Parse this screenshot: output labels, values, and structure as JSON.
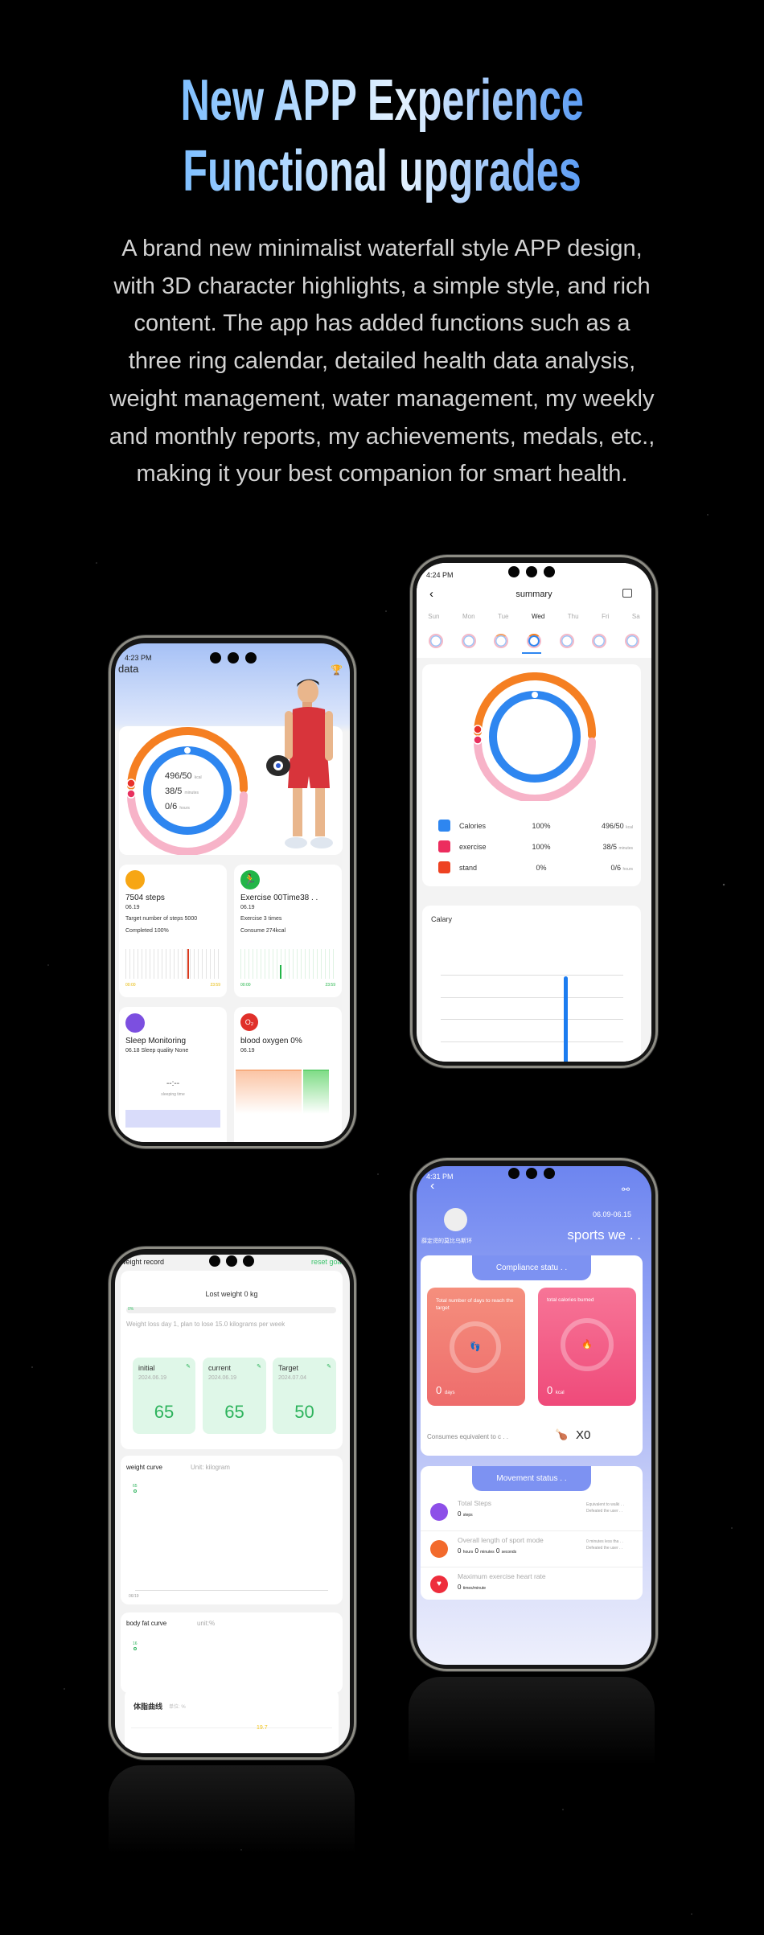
{
  "header": {
    "title_line1": "New APP Experience",
    "title_line2": "Functional upgrades",
    "description_lines": [
      "A brand new minimalist waterfall style APP design,",
      "with 3D character highlights, a simple style, and rich",
      "content. The app has added functions such as a",
      "three ring calendar, detailed health data analysis,",
      "weight management, water management, my weekly",
      "and monthly reports, my achievements, medals, etc.,",
      "making it your best companion for smart health."
    ]
  },
  "phone_data": {
    "status_time": "4:23 PM",
    "title": "data",
    "rings": {
      "calories": "496/50",
      "calories_unit": "kcal",
      "exercise": "38/5",
      "exercise_unit": "minutes",
      "stand": "0/6",
      "stand_unit": "hours"
    },
    "steps": {
      "title": "7504 steps",
      "date": "06.19",
      "target": "Target number of steps 5000",
      "completed": "Completed 100%",
      "start": "00:00",
      "end": "23:59"
    },
    "exercise": {
      "title": "Exercise 00Time38 . .",
      "date": "06.19",
      "times": "Exercise 3 times",
      "consume": "Consume 274kcal",
      "start": "00:00",
      "end": "23:59"
    },
    "sleep": {
      "title": "Sleep Monitoring",
      "subtitle": "06.18 Sleep quality None",
      "value": "--:--",
      "label": "sleeping time"
    },
    "oxygen": {
      "title": "blood oxygen 0%",
      "date": "06.19"
    }
  },
  "phone_summary": {
    "status_time": "4:24 PM",
    "title": "summary",
    "days": [
      "Sun",
      "Mon",
      "Tue",
      "Wed",
      "Thu",
      "Fri",
      "Sa"
    ],
    "selected_day": "Wed",
    "metrics": [
      {
        "label": "Calories",
        "percent": "100%",
        "value": "496/50",
        "unit": "kcal",
        "icon": "home-icon"
      },
      {
        "label": "exercise",
        "percent": "100%",
        "value": "38/5",
        "unit": "minutes",
        "icon": "stopwatch-icon"
      },
      {
        "label": "stand",
        "percent": "0%",
        "value": "0/6",
        "unit": "hours",
        "icon": "person-icon"
      }
    ],
    "chart_title": "Calary"
  },
  "phone_weight": {
    "title": "weight record",
    "reset": "reset goals",
    "lost": "Lost weight 0 kg",
    "progress_label": "0%",
    "progress_percent": 0,
    "plan": "Weight loss day 1, plan to lose 15.0 kilograms per week",
    "boxes": [
      {
        "label": "initial",
        "date": "2024.06.19",
        "value": "65"
      },
      {
        "label": "current",
        "date": "2024.06.19",
        "value": "65"
      },
      {
        "label": "Target",
        "date": "2024.07.04",
        "value": "50"
      }
    ],
    "weight_curve": {
      "title": "weight curve",
      "unit": "Unit: kilogram",
      "point": "65",
      "x_label": "06/19"
    },
    "body_fat": {
      "title": "body fat curve",
      "unit": "unit:%",
      "point": "16"
    },
    "cn_card": {
      "title": "体脂曲线",
      "unit": "单位: %",
      "point": "19.7"
    }
  },
  "phone_sports": {
    "status_time": "4:31 PM",
    "device": "薛定谔的莫比乌斯环",
    "date_range": "06.09-06.15",
    "title": "sports we . .",
    "compliance": "Compliance statu . .",
    "days_card": {
      "label": "Total number of days to reach the target",
      "value": "0",
      "unit": "days"
    },
    "kcal_card": {
      "label": "total calories burned",
      "value": "0",
      "unit": "kcal"
    },
    "equivalent": "Consumes equivalent to c . .",
    "equivalent_count": "X0",
    "movement": "Movement status . .",
    "rows": [
      {
        "title": "Total Steps",
        "v1": "0",
        "u1": "steps",
        "r1": "Equivalent to walki . .",
        "r2": "Defeated the user . ."
      },
      {
        "title": "Overall length of sport mode",
        "v1": "0",
        "u1": "hours",
        "v2": "0",
        "u2": "minutes",
        "v3": "0",
        "u3": "seconds",
        "r1": "0 minutes less tha . .",
        "r2": "Defeated the user . ."
      },
      {
        "title": "Maximum exercise heart rate",
        "v1": "0",
        "u1": "times/minute"
      }
    ]
  },
  "colors": {
    "orange_ring": "#f57f22",
    "blue_ring": "#2e86f0",
    "pink_ring": "#f7b3c8",
    "green": "#2db35c",
    "sports_blue": "#7188f2",
    "coral": "#f47a72",
    "pink": "#f25488"
  }
}
